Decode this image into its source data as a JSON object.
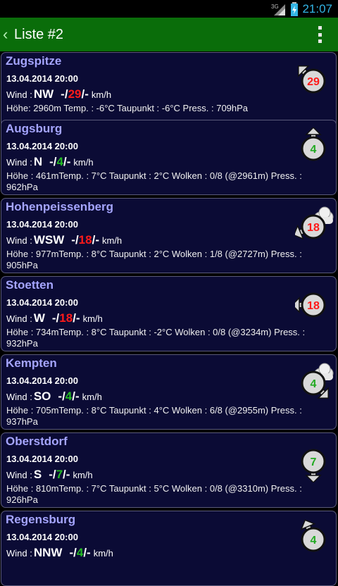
{
  "status": {
    "network": "3G",
    "time": "21:07"
  },
  "actionbar": {
    "title": "Liste #2",
    "back_icon": "chevron-left-icon",
    "menu_icon": "overflow-menu-icon"
  },
  "labels": {
    "wind": "Wind :",
    "unit": "km/h"
  },
  "colors": {
    "header": "#0a6d0a",
    "card": "#0b0b35",
    "station": "#a5a5ff",
    "strong": "#ff1a1a",
    "light": "#22bb22"
  },
  "stations": [
    {
      "name": "Zugspitze",
      "date": "13.04.2014 20:00",
      "dir": "NW",
      "speed": "29",
      "speed_pre": "-/",
      "speed_post": "/-",
      "speed_class": "red",
      "details": "Höhe: 2960m   Temp. : -6°C Taupunkt : -6°C Press. : 709hPa",
      "icon": "wind-arrow-nw-icon",
      "cloud": false
    },
    {
      "name": "Augsburg",
      "date": "13.04.2014 20:00",
      "dir": "N",
      "speed": "4",
      "speed_pre": "-/",
      "speed_post": "/-",
      "speed_class": "green",
      "details": "Höhe : 461mTemp. : 7°C   Taupunkt : 2°C   Wolken : 0/8 (@2961m)   Press. : 962hPa",
      "icon": "wind-arrow-n-icon",
      "cloud": false
    },
    {
      "name": "Hohenpeissenberg",
      "date": "13.04.2014 20:00",
      "dir": "WSW",
      "speed": "18",
      "speed_pre": "-/",
      "speed_post": "/-",
      "speed_class": "red",
      "details": "Höhe : 977mTemp. : 8°C   Taupunkt : 2°C   Wolken : 1/8 (@2727m)   Press. : 905hPa",
      "icon": "wind-arrow-wsw-icon",
      "cloud": true
    },
    {
      "name": "Stoetten",
      "date": "13.04.2014 20:00",
      "dir": "W",
      "speed": "18",
      "speed_pre": "-/",
      "speed_post": "/-",
      "speed_class": "red",
      "details": "Höhe : 734mTemp. : 8°C   Taupunkt : -2°C Wolken : 0/8 (@3234m)   Press. : 932hPa",
      "icon": "wind-arrow-w-icon",
      "cloud": false
    },
    {
      "name": "Kempten",
      "date": "13.04.2014 20:00",
      "dir": "SO",
      "speed": "4",
      "speed_pre": "-/",
      "speed_post": "/-",
      "speed_class": "green",
      "details": "Höhe : 705mTemp. : 8°C   Taupunkt : 4°C   Wolken : 6/8 (@2955m)   Press. : 937hPa",
      "icon": "wind-arrow-so-icon",
      "cloud": true
    },
    {
      "name": "Oberstdorf",
      "date": "13.04.2014 20:00",
      "dir": "S",
      "speed": "7",
      "speed_pre": "-/",
      "speed_post": "/-",
      "speed_class": "green",
      "details": "Höhe : 810mTemp. : 7°C   Taupunkt : 5°C   Wolken : 0/8 (@3310m)   Press. : 926hPa",
      "icon": "wind-arrow-s-icon",
      "cloud": false
    },
    {
      "name": "Regensburg",
      "date": "13.04.2014 20:00",
      "dir": "NNW",
      "speed": "4",
      "speed_pre": "-/",
      "speed_post": "/-",
      "speed_class": "green",
      "details": "",
      "icon": "wind-arrow-nnw-icon",
      "cloud": false
    }
  ]
}
